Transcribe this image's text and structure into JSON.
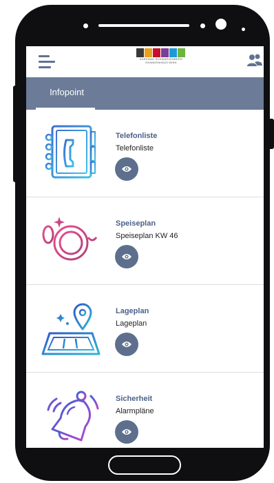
{
  "header": {
    "logo_text_line1": "KARDINAL SCHWARZENBERG",
    "logo_text_line2": "KRANKENHAUS WIEN"
  },
  "tabs": [
    {
      "label": "Infopoint",
      "active": true
    }
  ],
  "items": [
    {
      "title": "Telefonliste",
      "subtitle": "Telefonliste",
      "icon": "phonebook-icon"
    },
    {
      "title": "Speiseplan",
      "subtitle": "Speiseplan KW 46",
      "icon": "plate-cutlery-icon"
    },
    {
      "title": "Lageplan",
      "subtitle": "Lageplan",
      "icon": "map-pin-icon"
    },
    {
      "title": "Sicherheit",
      "subtitle": "Alarmpläne",
      "icon": "alarm-bell-icon"
    }
  ],
  "colors": {
    "tabbar": "#6b7b98",
    "title": "#4c6189",
    "view_button": "#5d6f8d"
  }
}
